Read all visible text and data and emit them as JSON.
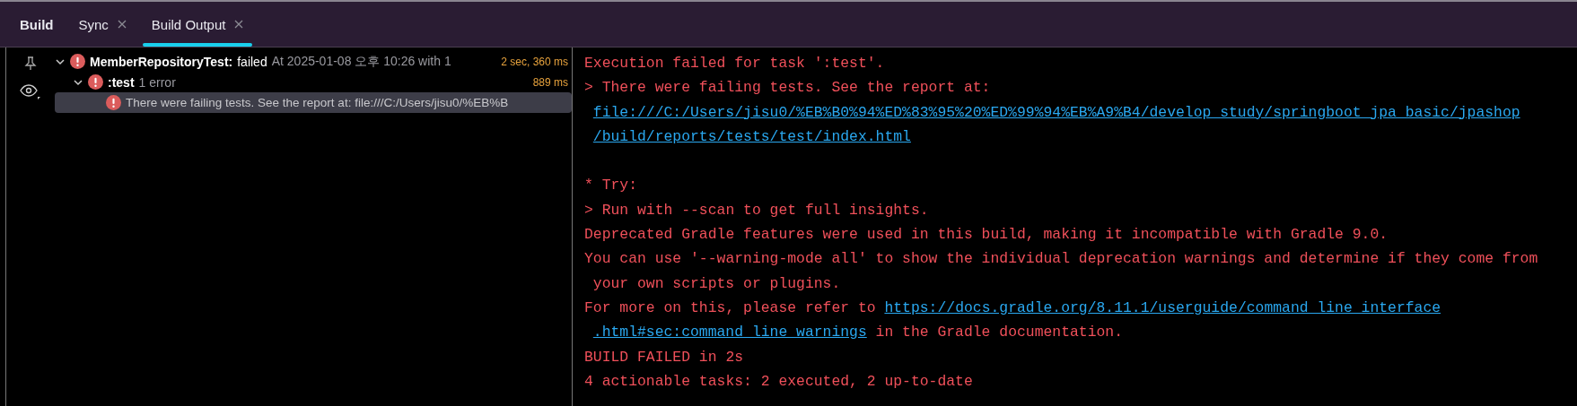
{
  "tabs": [
    {
      "label": "Build",
      "selected": false,
      "kind": "title"
    },
    {
      "label": "Sync",
      "selected": false,
      "kind": "closable"
    },
    {
      "label": "Build Output",
      "selected": true,
      "kind": "closable"
    }
  ],
  "tree": [
    {
      "name": "MemberRepositoryTest:",
      "status": "failed",
      "detail": "At 2025-01-08 오후 10:26 with 1",
      "duration": "2 sec, 360 ms",
      "expanded": true,
      "selected": false,
      "children": [
        {
          "name": ":test",
          "detail": "1 error",
          "duration": "889 ms",
          "expanded": true,
          "selected": false,
          "children": [
            {
              "detail": "There were failing tests. See the report at: file:///C:/Users/jisu0/%EB%B",
              "selected": true
            }
          ]
        }
      ]
    }
  ],
  "console": [
    {
      "kind": "line",
      "segments": [
        {
          "kind": "text",
          "text": "Execution failed for task ':test'."
        }
      ]
    },
    {
      "kind": "line",
      "segments": [
        {
          "kind": "text",
          "text": "> There were failing tests. See the report at:"
        }
      ]
    },
    {
      "kind": "wrap",
      "segments": [
        {
          "kind": "link",
          "text": "file:///C:/Users/jisu0/%EB%B0%94%ED%83%95%20%ED%99%94%EB%A9%B4/develop_study/springboot_jpa_basic/jpashop"
        }
      ]
    },
    {
      "kind": "wrap",
      "segments": [
        {
          "kind": "link",
          "text": "/build/reports/tests/test/index.html"
        }
      ]
    },
    {
      "kind": "blank"
    },
    {
      "kind": "line",
      "segments": [
        {
          "kind": "text",
          "text": "* Try:"
        }
      ]
    },
    {
      "kind": "line",
      "segments": [
        {
          "kind": "text",
          "text": "> Run with --scan to get full insights."
        }
      ]
    },
    {
      "kind": "line",
      "segments": [
        {
          "kind": "text",
          "text": "Deprecated Gradle features were used in this build, making it incompatible with Gradle 9.0."
        }
      ]
    },
    {
      "kind": "line",
      "segments": [
        {
          "kind": "text",
          "text": "You can use '--warning-mode all' to show the individual deprecation warnings and determine if they come from"
        }
      ]
    },
    {
      "kind": "wrap",
      "segments": [
        {
          "kind": "text",
          "text": "your own scripts or plugins."
        }
      ]
    },
    {
      "kind": "line",
      "segments": [
        {
          "kind": "text",
          "text": "For more on this, please refer to "
        },
        {
          "kind": "link",
          "text": "https://docs.gradle.org/8.11.1/userguide/command_line_interface"
        }
      ]
    },
    {
      "kind": "wrap",
      "segments": [
        {
          "kind": "link",
          "text": ".html#sec:command_line_warnings"
        },
        {
          "kind": "text",
          "text": " in the Gradle documentation."
        }
      ]
    },
    {
      "kind": "line",
      "segments": [
        {
          "kind": "text",
          "text": "BUILD FAILED in 2s"
        }
      ]
    },
    {
      "kind": "line",
      "segments": [
        {
          "kind": "text",
          "text": "4 actionable tasks: 2 executed, 2 up-to-date"
        }
      ]
    }
  ]
}
